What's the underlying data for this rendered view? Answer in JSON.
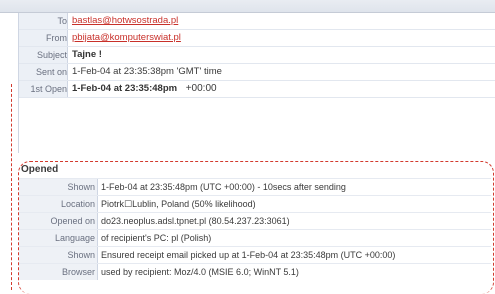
{
  "header": {
    "to_label": "To",
    "to_value": "bastlas@hotwsostrada.pl",
    "from_label": "From",
    "from_value": "pbijata@komputerswiat.pl",
    "subject_label": "Subject",
    "subject_value": "Tajne !",
    "sent_label": "Sent on",
    "sent_value": "1-Feb-04 at 23:35:38pm 'GMT' time",
    "first_open_label": "1st Open",
    "first_open_value": "1-Feb-04 at 23:35:48pm",
    "first_open_tz": "+00:00"
  },
  "opened": {
    "title": "Opened",
    "rows": [
      {
        "label": "Shown",
        "value": "1-Feb-04 at 23:35:48pm (UTC +00:00)  -  10secs after sending"
      },
      {
        "label": "Location",
        "value": "Piotrk☐Lublin, Poland (50% likelihood)"
      },
      {
        "label": "Opened on",
        "value": "do23.neoplus.adsl.tpnet.pl (80.54.237.23:3061)"
      },
      {
        "label": "Language",
        "value": "of recipient's PC: pl (Polish)"
      },
      {
        "label": "Shown",
        "value": "Ensured receipt email picked up at 1-Feb-04 at 23:35:48pm (UTC +00:00)"
      },
      {
        "label": "Browser",
        "value": "used by recipient: Moz/4.0 (MSIE 6.0; WinNT 5.1)"
      }
    ]
  }
}
